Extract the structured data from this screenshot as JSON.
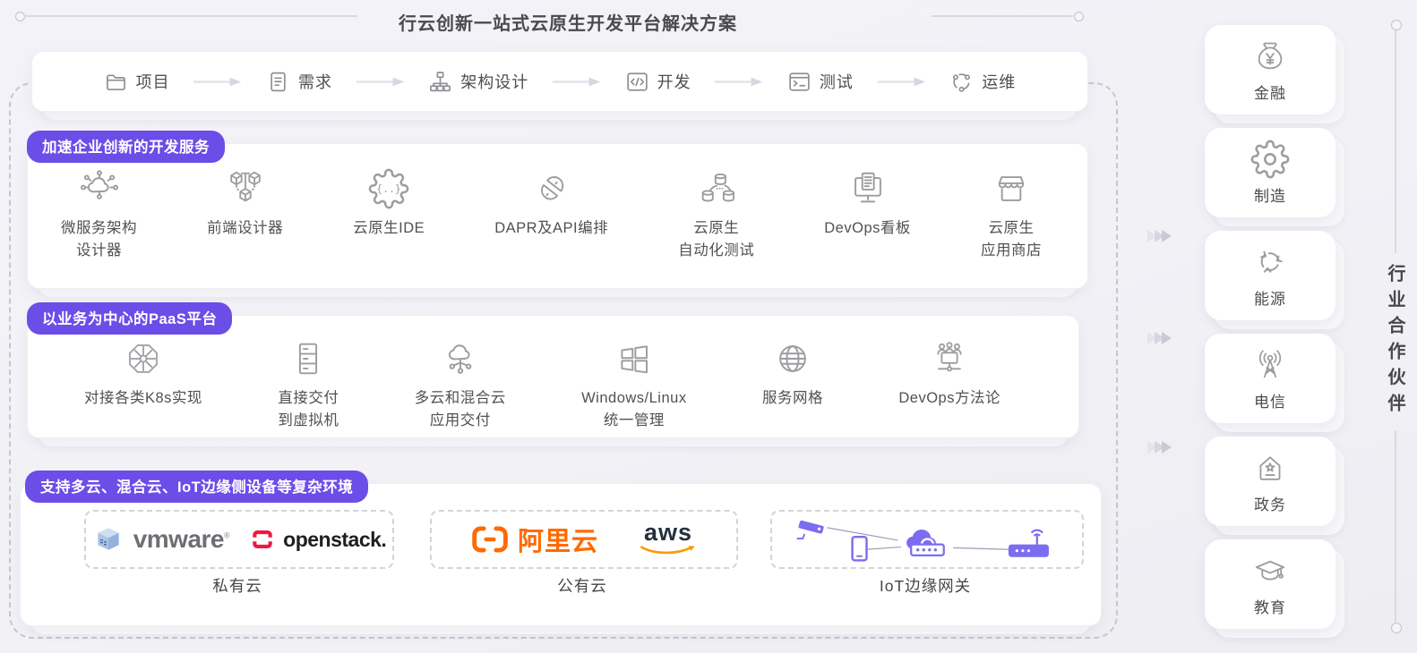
{
  "title": "行云创新一站式云原生开发平台解决方案",
  "workflow": {
    "steps": [
      {
        "icon": "folder",
        "label": "项目"
      },
      {
        "icon": "document",
        "label": "需求"
      },
      {
        "icon": "sitemap",
        "label": "架构设计"
      },
      {
        "icon": "code-window",
        "label": "开发"
      },
      {
        "icon": "terminal",
        "label": "测试"
      },
      {
        "icon": "ops-cycle",
        "label": "运维"
      }
    ]
  },
  "sections": [
    {
      "badge": "加速企业创新的开发服务",
      "items": [
        {
          "icon": "microservice-architecture",
          "lines": [
            "微服务架构",
            "设计器"
          ]
        },
        {
          "icon": "frontend-designer",
          "lines": [
            "前端设计器"
          ]
        },
        {
          "icon": "cloud-native-ide",
          "lines": [
            "云原生IDE"
          ]
        },
        {
          "icon": "dapr-api",
          "lines": [
            "DAPR及API编排"
          ]
        },
        {
          "icon": "cloud-auto-test",
          "lines": [
            "云原生",
            "自动化测试"
          ]
        },
        {
          "icon": "devops-board",
          "lines": [
            "DevOps看板"
          ]
        },
        {
          "icon": "app-store",
          "lines": [
            "云原生",
            "应用商店"
          ]
        }
      ]
    },
    {
      "badge": "以业务为中心的PaaS平台",
      "items": [
        {
          "icon": "k8s-wheel",
          "lines": [
            "对接各类K8s实现"
          ]
        },
        {
          "icon": "server-rack",
          "lines": [
            "直接交付",
            "到虚拟机"
          ]
        },
        {
          "icon": "multicloud",
          "lines": [
            "多云和混合云",
            "应用交付"
          ]
        },
        {
          "icon": "windows",
          "lines": [
            "Windows/Linux",
            "统一管理"
          ]
        },
        {
          "icon": "globe",
          "lines": [
            "服务网格"
          ]
        },
        {
          "icon": "devops-method",
          "lines": [
            "DevOps方法论"
          ]
        }
      ]
    },
    {
      "badge": "支持多云、混合云、IoT边缘侧设备等复杂环境",
      "groups": [
        {
          "label": "私有云"
        },
        {
          "label": "公有云"
        },
        {
          "label": "IoT边缘网关"
        }
      ]
    }
  ],
  "logos": {
    "vmware": "vmware",
    "vmware_reg": "®",
    "openstack": "openstack.",
    "alibaba": "阿里云",
    "aws": "aws"
  },
  "sidebar": {
    "title": "行业合作伙伴",
    "items": [
      {
        "icon": "money-bag",
        "label": "金融"
      },
      {
        "icon": "gear",
        "label": "制造"
      },
      {
        "icon": "recycle",
        "label": "能源"
      },
      {
        "icon": "radio-tower",
        "label": "电信"
      },
      {
        "icon": "gov-building",
        "label": "政务"
      },
      {
        "icon": "graduation-cap",
        "label": "教育"
      }
    ]
  },
  "colors": {
    "accent_purple": "#6b4de8",
    "iot_purple": "#7c6cf2",
    "alibaba_orange": "#ff6a00",
    "aws_navy": "#252f3e",
    "aws_orange": "#ff9900",
    "openstack_red": "#ed1944",
    "icon_gray": "#9c9ca1"
  }
}
